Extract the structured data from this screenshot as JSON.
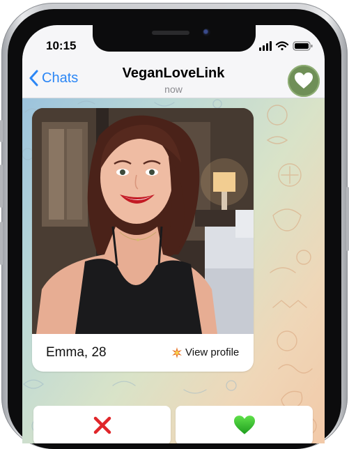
{
  "status_bar": {
    "time": "10:15"
  },
  "nav": {
    "back_label": "Chats",
    "title": "VeganLoveLink",
    "subtitle": "now"
  },
  "profile": {
    "name_age": "Emma, 28",
    "view_profile_label": "View profile",
    "view_profile_icon": "sparkle-burst-icon",
    "photo_icon": "profile-photo"
  },
  "actions": {
    "reject_icon": "cross-mark-icon",
    "like_icon": "green-heart-icon"
  },
  "colors": {
    "accent_blue": "#2b86f5",
    "avatar_green": "#6f8f57",
    "reject_red": "#e0262a",
    "like_green": "#2fbf2a"
  }
}
